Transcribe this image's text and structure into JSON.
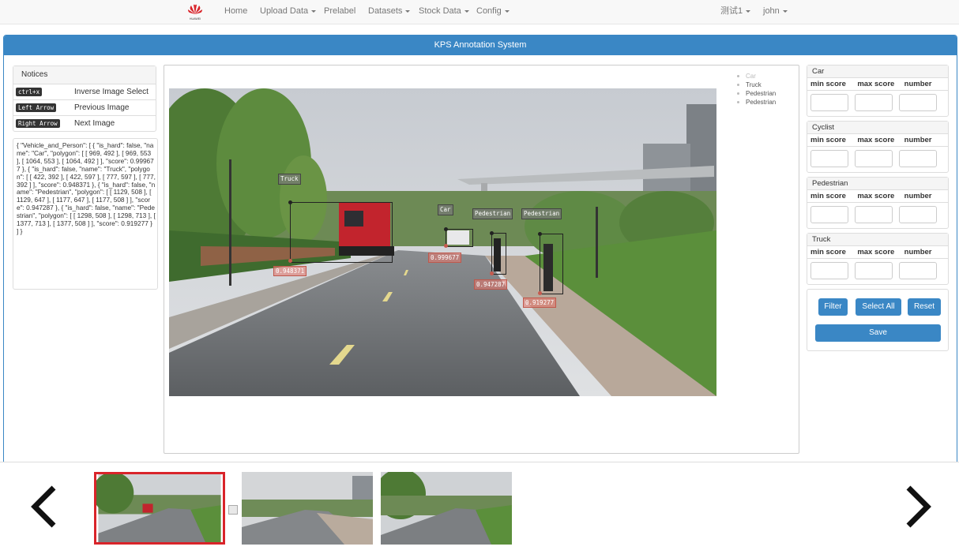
{
  "nav": {
    "logo_text": "HUAWEI",
    "items": [
      {
        "label": "Home",
        "dropdown": false
      },
      {
        "label": "Upload Data",
        "dropdown": true
      },
      {
        "label": "Prelabel",
        "dropdown": false
      },
      {
        "label": "Datasets",
        "dropdown": true
      },
      {
        "label": "Stock Data",
        "dropdown": true
      },
      {
        "label": "Config",
        "dropdown": true
      }
    ],
    "right_items": [
      {
        "label": "测试1",
        "dropdown": true
      },
      {
        "label": "john",
        "dropdown": true
      }
    ]
  },
  "panel_title": "KPS Annotation System",
  "notices": {
    "title": "Notices",
    "rows": [
      {
        "key": "ctrl+x",
        "desc": "Inverse Image Select"
      },
      {
        "key": "Left Arrow",
        "desc": "Previous Image"
      },
      {
        "key": "Right Arrow",
        "desc": "Next Image"
      }
    ]
  },
  "json_text": "{ \"Vehicle_and_Person\": [ { \"is_hard\": false, \"name\": \"Car\", \"polygon\": [ [ 969, 492 ], [ 969, 553 ], [ 1064, 553 ], [ 1064, 492 ] ], \"score\": 0.999677 }, { \"is_hard\": false, \"name\": \"Truck\", \"polygon\": [ [ 422, 392 ], [ 422, 597 ], [ 777, 597 ], [ 777, 392 ] ], \"score\": 0.948371 }, { \"is_hard\": false, \"name\": \"Pedestrian\", \"polygon\": [ [ 1129, 508 ], [ 1129, 647 ], [ 1177, 647 ], [ 1177, 508 ] ], \"score\": 0.947287 }, { \"is_hard\": false, \"name\": \"Pedestrian\", \"polygon\": [ [ 1298, 508 ], [ 1298, 713 ], [ 1377, 713 ], [ 1377, 508 ] ], \"score\": 0.919277 } ] }",
  "legend": [
    "Car",
    "Truck",
    "Pedestrian",
    "Pedestrian"
  ],
  "detections": [
    {
      "label": "Truck",
      "score": "0.948371"
    },
    {
      "label": "Car",
      "score": "0.999677"
    },
    {
      "label": "Pedestrian",
      "score": "0.947287"
    },
    {
      "label": "Pedestrian",
      "score": "0.919277"
    }
  ],
  "filters": {
    "columns": [
      "min score",
      "max score",
      "number"
    ],
    "classes": [
      "Car",
      "Cyclist",
      "Pedestrian",
      "Truck"
    ]
  },
  "buttons": {
    "filter": "Filter",
    "select_all": "Select All",
    "reset": "Reset",
    "save": "Save"
  },
  "strip": {
    "prev_icon": "chevron-left-icon",
    "next_icon": "chevron-right-icon",
    "prev_glyph": "‹",
    "next_glyph": "›",
    "thumbnail_count": 3,
    "selected_index": 0
  },
  "colors": {
    "primary": "#3a87c5",
    "selected_border": "#d9242a",
    "score_tag": "#e1786e"
  }
}
